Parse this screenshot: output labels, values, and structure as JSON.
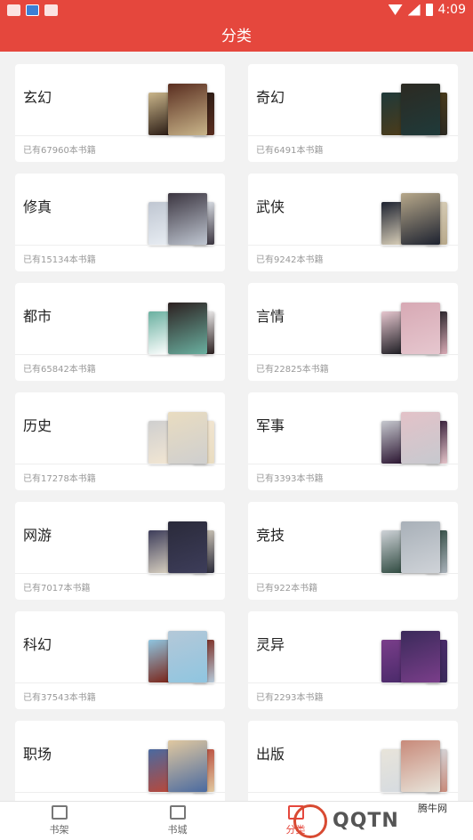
{
  "statusbar": {
    "time": "4:09"
  },
  "header": {
    "title": "分类"
  },
  "categories": [
    {
      "name": "玄幻",
      "count": "已有67960本书籍",
      "colors": [
        "#c9b58a",
        "#2a1b14",
        "#5a2e20"
      ]
    },
    {
      "name": "奇幻",
      "count": "已有6491本书籍",
      "colors": [
        "#1f3a3a",
        "#4b3b1a",
        "#2c2a22"
      ]
    },
    {
      "name": "修真",
      "count": "已有15134本书籍",
      "colors": [
        "#bfc6d1",
        "#e8edf3",
        "#3b3540"
      ]
    },
    {
      "name": "武侠",
      "count": "已有9242本书籍",
      "colors": [
        "#1d2230",
        "#d9cfb9",
        "#b7a88a"
      ]
    },
    {
      "name": "都市",
      "count": "已有65842本书籍",
      "colors": [
        "#6ab0a0",
        "#ffffff",
        "#2c2020"
      ]
    },
    {
      "name": "言情",
      "count": "已有22825本书籍",
      "colors": [
        "#e6c7cf",
        "#1c1c22",
        "#d7a9b4"
      ]
    },
    {
      "name": "历史",
      "count": "已有17278本书籍",
      "colors": [
        "#cfcfcf",
        "#f2e6d3",
        "#e9dcc0"
      ]
    },
    {
      "name": "军事",
      "count": "已有3393本书籍",
      "colors": [
        "#c7c9cf",
        "#2a1430",
        "#e3c2c8"
      ]
    },
    {
      "name": "网游",
      "count": "已有7017本书籍",
      "colors": [
        "#3d3d5a",
        "#d8d0c0",
        "#2a2a3a"
      ]
    },
    {
      "name": "竞技",
      "count": "已有922本书籍",
      "colors": [
        "#cfd3d8",
        "#2f4a40",
        "#a8b0b8"
      ]
    },
    {
      "name": "科幻",
      "count": "已有37543本书籍",
      "colors": [
        "#8fc5e0",
        "#7a2418",
        "#b4c8d8"
      ]
    },
    {
      "name": "灵异",
      "count": "已有2293本书籍",
      "colors": [
        "#7a3e8a",
        "#4a2a6a",
        "#3a2a5a"
      ]
    },
    {
      "name": "职场",
      "count": "",
      "colors": [
        "#4a6aa0",
        "#b8483a",
        "#e0c8a0"
      ]
    },
    {
      "name": "出版",
      "count": "",
      "colors": [
        "#e8e4da",
        "#d6dbe0",
        "#c88a7a"
      ]
    }
  ],
  "nav": {
    "shelf": "书架",
    "store": "书城",
    "category": "分类"
  },
  "watermark": {
    "brand": "QQTN",
    "site": "腾牛网"
  }
}
